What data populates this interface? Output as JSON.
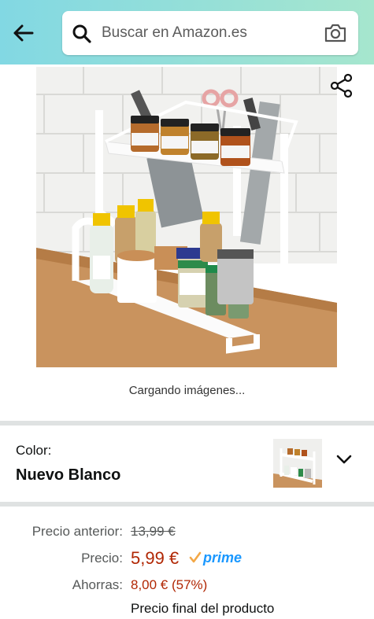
{
  "header": {
    "search_placeholder": "Buscar en Amazon.es",
    "gradient_start": "#82d8e3",
    "gradient_end": "#a6e6ce"
  },
  "icons": {
    "back": "arrow-left-icon",
    "search": "search-icon",
    "camera": "camera-icon",
    "share": "share-icon",
    "chevron": "chevron-down-icon"
  },
  "gallery": {
    "loading_text": "Cargando imágenes..."
  },
  "variation": {
    "label": "Color:",
    "value": "Nuevo Blanco"
  },
  "price": {
    "previous_label": "Precio anterior:",
    "previous_value": "13,99 €",
    "current_label": "Precio:",
    "current_value": "5,99 €",
    "prime_label": "prime",
    "savings_label": "Ahorras:",
    "savings_value": "8,00 € (57%)",
    "final_note": "Precio final del producto",
    "price_color": "#b12704",
    "prime_color": "#1a98ff"
  }
}
